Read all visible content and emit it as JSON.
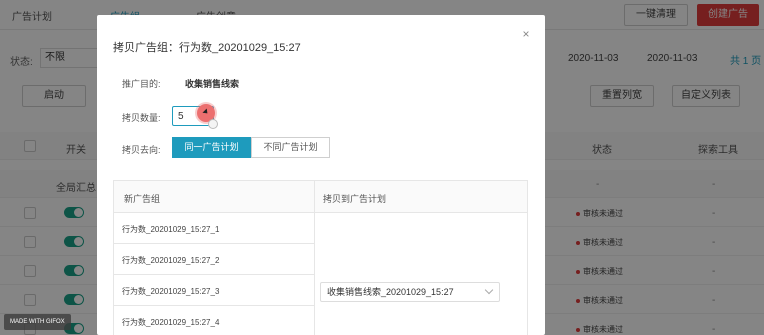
{
  "app": {
    "nav_tabs": [
      "广告计划",
      "广告组",
      "广告创意"
    ],
    "clear_button": "一键清理",
    "create_button": "创建广告",
    "filter": {
      "label": "状态:",
      "value": "不限"
    },
    "date_start": "2020-11-03",
    "date_end": "2020-11-03",
    "pager_text": "共 1 页",
    "toolbar": {
      "start_button": "启动",
      "reset_columns": "重置列宽",
      "custom_columns": "自定义列表"
    },
    "table": {
      "headers": {
        "switch": "开关",
        "status": "状态",
        "explore": "探索工具"
      },
      "summary_label": "全局汇总",
      "dash": "-",
      "row_status": "审核未通过"
    }
  },
  "modal": {
    "title": "拷贝广告组：行为数_20201029_15:27",
    "close_glyph": "×",
    "purpose": {
      "label": "推广目的:",
      "value": "收集销售线索"
    },
    "quantity": {
      "label": "拷贝数量:",
      "value": "5"
    },
    "direction": {
      "label": "拷贝去向:",
      "options": [
        "同一广告计划",
        "不同广告计划"
      ],
      "selected": "同一广告计划"
    },
    "table": {
      "col_new_group": "新广告组",
      "col_copy_to": "拷贝到广告计划",
      "rows": [
        "行为数_20201029_15:27_1",
        "行为数_20201029_15:27_2",
        "行为数_20201029_15:27_3",
        "行为数_20201029_15:27_4"
      ],
      "plan_select": "收集销售线索_20201029_15:27"
    }
  },
  "badge": "MADE WITH GIFOX",
  "colors": {
    "accent": "#1e9bbd",
    "danger": "#e33d3d",
    "toggle": "#1aa188"
  }
}
